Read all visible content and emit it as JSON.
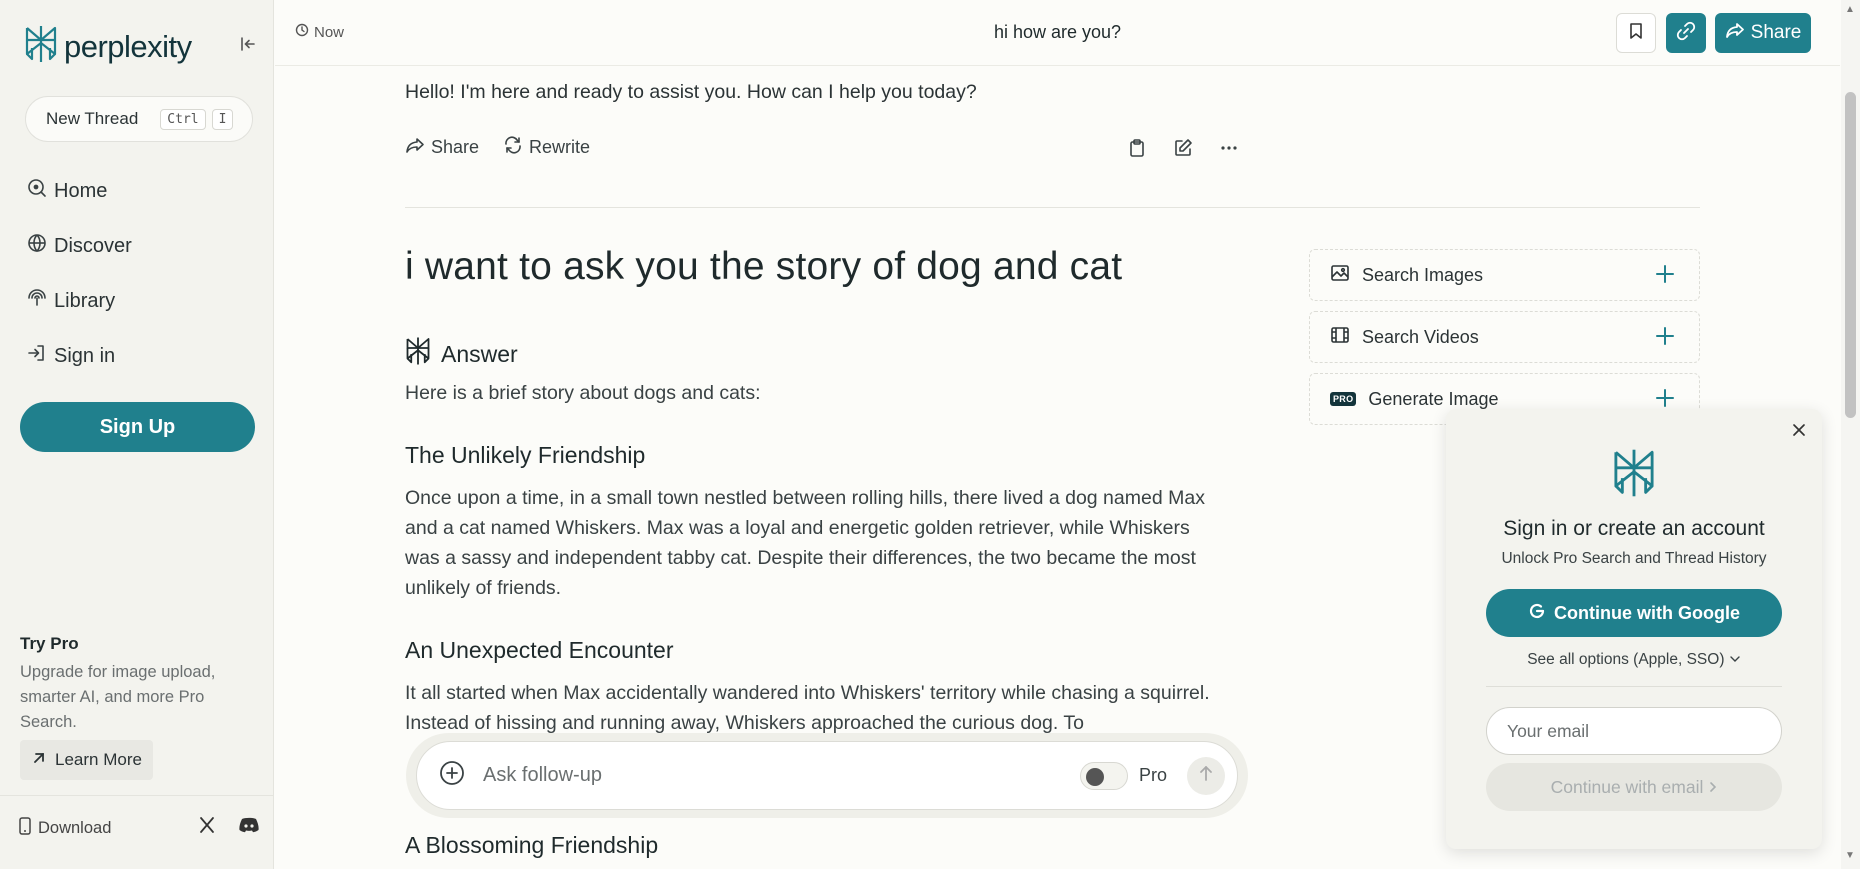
{
  "sidebar": {
    "logo_text": "perplexity",
    "new_thread": {
      "label": "New Thread",
      "keys": [
        "Ctrl",
        "I"
      ]
    },
    "nav": [
      {
        "label": "Home",
        "icon": "home-icon"
      },
      {
        "label": "Discover",
        "icon": "globe-icon"
      },
      {
        "label": "Library",
        "icon": "library-icon"
      },
      {
        "label": "Sign in",
        "icon": "sign-in-icon"
      }
    ],
    "signup_label": "Sign Up",
    "try_pro": {
      "title": "Try Pro",
      "text": "Upgrade for image upload, smarter AI, and more Pro Search.",
      "learn_more": "Learn More"
    },
    "download_label": "Download"
  },
  "topbar": {
    "time": "Now",
    "title": "hi how are you?",
    "share_label": "Share"
  },
  "thread": {
    "previous_answer": "Hello! I'm here and ready to assist you. How can I help you today?",
    "actions": {
      "share": "Share",
      "rewrite": "Rewrite"
    },
    "question": "i want to ask you the story of dog and cat",
    "answer_label": "Answer",
    "intro": "Here is a brief story about dogs and cats:",
    "sections": [
      {
        "heading": "The Unlikely Friendship",
        "body": "Once upon a time, in a small town nestled between rolling hills, there lived a dog named Max and a cat named Whiskers. Max was a loyal and energetic golden retriever, while Whiskers was a sassy and independent tabby cat. Despite their differences, the two became the most unlikely of friends."
      },
      {
        "heading": "An Unexpected Encounter",
        "body": "It all started when Max accidentally wandered into Whiskers' territory while chasing a squirrel. Instead of hissing and running away, Whiskers approached the curious dog. To"
      },
      {
        "heading": "A Blossoming Friendship",
        "body": ""
      }
    ]
  },
  "rail": [
    {
      "label": "Search Images",
      "icon": "image-icon"
    },
    {
      "label": "Search Videos",
      "icon": "video-icon"
    },
    {
      "label": "Generate Image",
      "icon": "pro-badge",
      "badge": "PRO"
    }
  ],
  "followup": {
    "placeholder": "Ask follow-up",
    "pro_label": "Pro",
    "pro_enabled": false
  },
  "signin_card": {
    "title": "Sign in or create an account",
    "subtitle": "Unlock Pro Search and Thread History",
    "google_label": "Continue with Google",
    "options_label": "See all options (Apple, SSO)",
    "email_placeholder": "Your email",
    "email_button": "Continue with email"
  },
  "colors": {
    "accent": "#20808d",
    "brand_dark": "#13343b",
    "background": "#fcfcf9",
    "sidebar_bg": "#f3f3ee"
  }
}
